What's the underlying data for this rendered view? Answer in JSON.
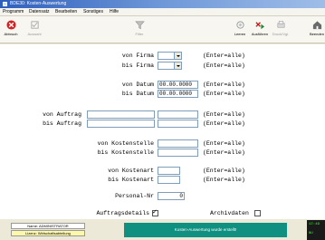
{
  "window": {
    "title": "BDE30: Kosten-Auswertung"
  },
  "menu": [
    "Programm",
    "Datensatz",
    "Bearbeiten",
    "Sonstiges",
    "Hilfe"
  ],
  "toolbar": {
    "abbruch": "Abbruch",
    "auswahl": "Auswahl",
    "filter": "Filter",
    "leeren": "Leeren",
    "ausfuehren": "Ausführen",
    "druckvorlage": "Druck/Vgl.",
    "beenden": "Beenden"
  },
  "form": {
    "von_firma": {
      "label": "von Firma",
      "value": "",
      "hint": "(Enter=alle)"
    },
    "bis_firma": {
      "label": "bis Firma",
      "value": "",
      "hint": "(Enter=alle)"
    },
    "von_datum": {
      "label": "von Datum",
      "value": "00.00.0000",
      "hint": "(Enter=alle)"
    },
    "bis_datum": {
      "label": "bis Datum",
      "value": "00.00.0000",
      "hint": "(Enter=alle)"
    },
    "von_auftrag": {
      "label": "von Auftrag",
      "value": "",
      "hint": "(Enter=alle)"
    },
    "bis_auftrag": {
      "label": "bis Auftrag",
      "value": "",
      "hint": "(Enter=alle)"
    },
    "von_kostenstelle": {
      "label": "von Kostenstelle",
      "value": "",
      "hint": "(Enter=alle)"
    },
    "bis_kostenstelle": {
      "label": "bis Kostenstelle",
      "value": "",
      "hint": "(Enter=alle)"
    },
    "von_kostenart": {
      "label": "von Kostenart",
      "value": "",
      "hint": "(Enter=alle)"
    },
    "bis_kostenart": {
      "label": "bis Kostenart",
      "value": "",
      "hint": "(Enter=alle)"
    },
    "personal_nr": {
      "label": "Personal-Nr",
      "value": "0"
    },
    "auftragsdetails": {
      "label": "Auftragsdetails",
      "checked": true
    },
    "archivdaten": {
      "label": "Archivdaten",
      "checked": false
    }
  },
  "status": {
    "user": "Name: ADMINISTRATOR",
    "license": "Lizenz: Wirtschaftsabteilung",
    "message": "Kosten-Auswertung wurde erstellt!",
    "tray_top": "17:49",
    "tray_bottom": "NU"
  },
  "colors": {
    "title_bar": "#2f5fbd",
    "message_bg": "#0f9080",
    "license_bg": "#fff8a8"
  }
}
